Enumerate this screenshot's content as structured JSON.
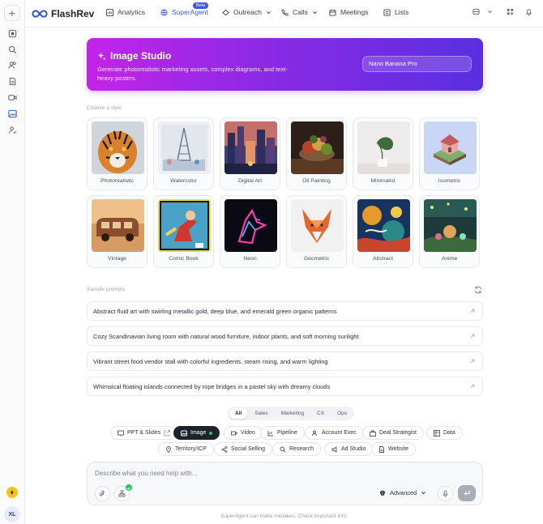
{
  "app": {
    "name": "FlashRev"
  },
  "nav": {
    "items": [
      {
        "label": "Analytics",
        "icon": "chart-icon"
      },
      {
        "label": "SuperAgent",
        "icon": "sparkle-globe-icon",
        "active": true,
        "badge": "Beta"
      },
      {
        "label": "Outreach",
        "icon": "outreach-icon",
        "dropdown": true
      },
      {
        "label": "Calls",
        "icon": "phone-icon",
        "dropdown": true
      },
      {
        "label": "Meetings",
        "icon": "calendar-icon"
      },
      {
        "label": "Lists",
        "icon": "list-icon"
      }
    ]
  },
  "sidebar": {
    "icons": [
      "plus-icon",
      "home-icon",
      "search-icon",
      "users-icon",
      "document-icon",
      "video-icon",
      "image-icon",
      "contact-icon"
    ],
    "user_initials": "XL"
  },
  "hero": {
    "title": "Image Studio",
    "subtitle": "Generate photorealistic marketing assets, complex diagrams, and text-heavy posters.",
    "model": "Nano Banana Pro"
  },
  "styles": {
    "heading": "Choose a style",
    "items": [
      "Photorealistic",
      "Watercolor",
      "Digital Art",
      "Oil Painting",
      "Minimalist",
      "Isometric",
      "Vintage",
      "Comic Book",
      "Neon",
      "Geometric",
      "Abstract",
      "Anime"
    ]
  },
  "samples": {
    "heading": "Sample prompts",
    "items": [
      "Abstract fluid art with swirling metallic gold, deep blue, and emerald green organic patterns",
      "Cozy Scandinavian living room with natural wood furniture, indoor plants, and soft morning sunlight",
      "Vibrant street food vendor stall with colorful ingredients, steam rising, and warm lighting",
      "Whimsical floating islands connected by rope bridges in a pastel sky with dreamy clouds"
    ]
  },
  "categories": {
    "items": [
      "All",
      "Sales",
      "Marketing",
      "CX",
      "Ops"
    ],
    "active": "All"
  },
  "agents": {
    "row1": [
      "PPT & Slides",
      "Image",
      "Video",
      "Pipeline",
      "Account Exec",
      "Deal Strategist",
      "Data"
    ],
    "row2": [
      "Territory/ICP",
      "Social Selling",
      "Research",
      "Ad Studio",
      "Website"
    ],
    "active": "Image"
  },
  "composer": {
    "placeholder": "Describe what you need help with...",
    "mode": "Advanced"
  },
  "footer": "SuperAgent can make mistakes. Check important info.",
  "colors": {
    "accent": "#3b5bdb",
    "hero_start": "#c424e8",
    "hero_end": "#5a2fe0",
    "ok": "#22c55e"
  }
}
